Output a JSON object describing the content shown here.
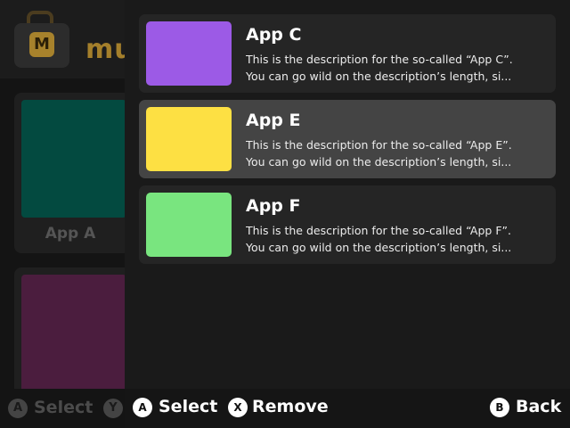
{
  "background": {
    "logo_letter": "M",
    "title": "mu",
    "card_label": "App A",
    "footer": {
      "a_glyph": "A",
      "select_label": "Select",
      "y_glyph": "Y"
    }
  },
  "items": [
    {
      "title": "App C",
      "color": "#9c5ae6",
      "desc_line1": "This is the description for the so-called “App C”.",
      "desc_line2": "You can go wild on the description’s length, si...",
      "selected": false
    },
    {
      "title": "App E",
      "color": "#fde043",
      "desc_line1": "This is the description for the so-called “App E”.",
      "desc_line2": "You can go wild on the description’s length, si...",
      "selected": true
    },
    {
      "title": "App F",
      "color": "#79e57f",
      "desc_line1": "This is the description for the so-called “App F”.",
      "desc_line2": "You can go wild on the description’s length, si...",
      "selected": false
    }
  ],
  "footer": {
    "a_glyph": "A",
    "select_label": "Select",
    "x_glyph": "X",
    "remove_label": "Remove",
    "b_glyph": "B",
    "back_label": "Back"
  },
  "colors": {
    "accent": "#a47f2b",
    "panel": "#1a1a1a",
    "item": "#252525",
    "item_selected": "#444444"
  }
}
